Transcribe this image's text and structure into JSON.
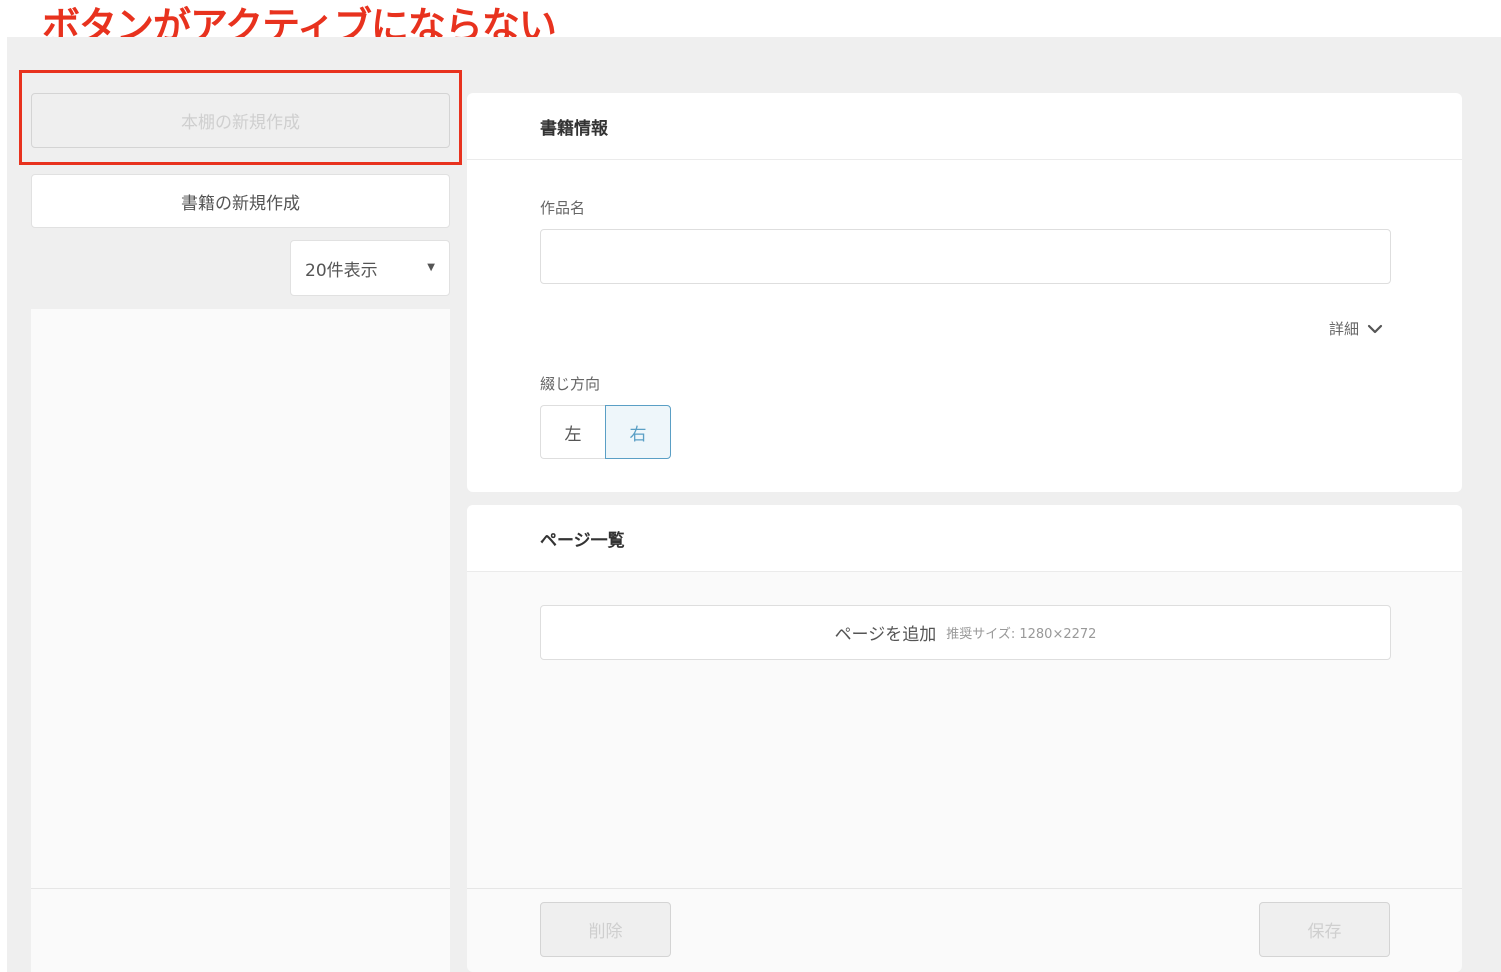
{
  "annotation": {
    "text": "ボタンがアクティブにならない",
    "color": "#e8321e"
  },
  "sidebar": {
    "new_shelf_label": "本棚の新規作成",
    "new_book_label": "書籍の新規作成",
    "page_size": {
      "selected": "20件表示",
      "caret": "▼"
    }
  },
  "book_info": {
    "title": "書籍情報",
    "work_name_label": "作品名",
    "work_name_value": "",
    "details_label": "詳細",
    "binding_label": "綴じ方向",
    "binding_options": [
      "左",
      "右"
    ],
    "binding_selected": "右"
  },
  "pages": {
    "title": "ページ一覧",
    "add_label": "ページを追加",
    "add_hint": "推奨サイズ: 1280×2272",
    "delete_label": "削除",
    "save_label": "保存"
  },
  "colors": {
    "accent": "#5a9fc5",
    "annotation": "#e8321e",
    "disabled_text": "#cfcfcf",
    "background": "#efefef"
  }
}
